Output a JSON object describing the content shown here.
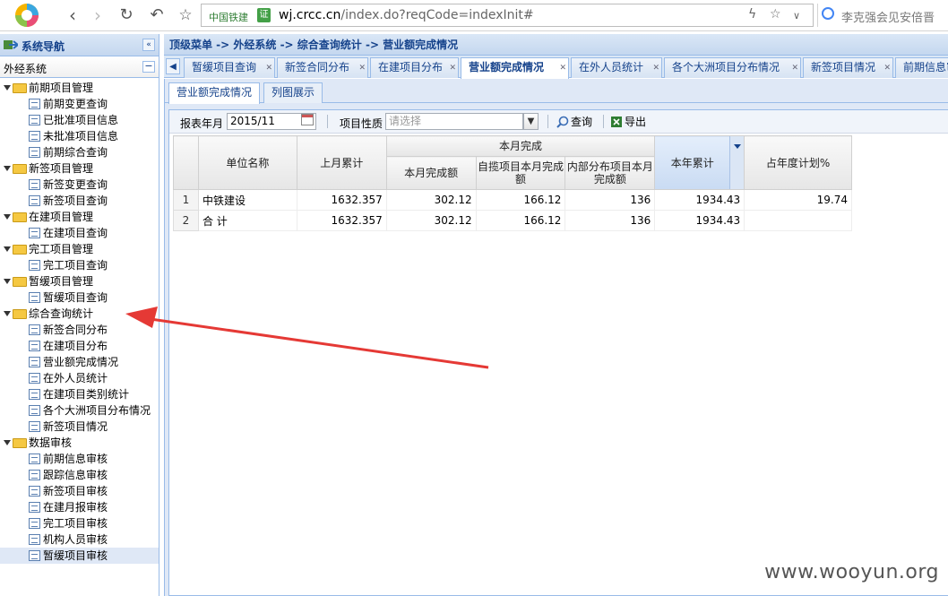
{
  "browser": {
    "site_name": "中国铁建",
    "cert_badge": "证",
    "url_host": "wj.crcc.cn",
    "url_rest": "/index.do?reqCode=indexInit#",
    "search_text": "李克强会见安倍晋"
  },
  "sidebar": {
    "title": "系统导航",
    "collapse_glyph": "«",
    "system": "外经系统",
    "minus_glyph": "−",
    "tree": [
      {
        "label": "前期项目管理",
        "children": [
          "前期变更查询",
          "已批准项目信息",
          "未批准项目信息",
          "前期综合查询"
        ]
      },
      {
        "label": "新签项目管理",
        "children": [
          "新签变更查询",
          "新签项目查询"
        ]
      },
      {
        "label": "在建项目管理",
        "children": [
          "在建项目查询"
        ]
      },
      {
        "label": "完工项目管理",
        "children": [
          "完工项目查询"
        ]
      },
      {
        "label": "暂缓项目管理",
        "children": [
          "暂缓项目查询"
        ]
      },
      {
        "label": "综合查询统计",
        "children": [
          "新签合同分布",
          "在建项目分布",
          "营业额完成情况",
          "在外人员统计",
          "在建项目类别统计",
          "各个大洲项目分布情况",
          "新签项目情况"
        ]
      },
      {
        "label": "数据审核",
        "children": [
          "前期信息审核",
          "跟踪信息审核",
          "新签项目审核",
          "在建月报审核",
          "完工项目审核",
          "机构人员审核",
          "暂缓项目审核"
        ]
      }
    ],
    "selected": "暂缓项目审核"
  },
  "breadcrumb": "顶级菜单 -> 外经系统 -> 综合查询统计 -> 营业额完成情况",
  "tabs": [
    "暂缓项目查询",
    "新签合同分布",
    "在建项目分布",
    "营业额完成情况",
    "在外人员统计",
    "各个大洲项目分布情况",
    "新签项目情况",
    "前期信息审"
  ],
  "active_tab": "营业额完成情况",
  "subtabs": [
    "营业额完成情况",
    "列图展示"
  ],
  "toolbar": {
    "year_month_label": "报表年月",
    "year_month_value": "2015/11",
    "nature_label": "项目性质",
    "nature_placeholder": "请选择",
    "query_label": "查询",
    "export_label": "导出"
  },
  "grid": {
    "headers": {
      "unit": "单位名称",
      "last_month_total": "上月累计",
      "this_month_group": "本月完成",
      "this_month_amount": "本月完成额",
      "self_month": "自揽项目本月完成额",
      "internal_month": "内部分布项目本月完成额",
      "year_total": "本年累计",
      "plan_pct": "占年度计划%"
    },
    "rows": [
      {
        "idx": "1",
        "unit": "中铁建设",
        "last": "1632.357",
        "month": "302.12",
        "self": "166.12",
        "internal": "136",
        "year": "1934.43",
        "pct": "19.74"
      },
      {
        "idx": "2",
        "unit": "合 计",
        "last": "1632.357",
        "month": "302.12",
        "self": "166.12",
        "internal": "136",
        "year": "1934.43",
        "pct": ""
      }
    ]
  },
  "watermark": "www.wooyun.org",
  "colors": {
    "annotation_arrow": "#e53935",
    "header_blue": "#15428b",
    "panel_bg": "#dfe8f6"
  }
}
